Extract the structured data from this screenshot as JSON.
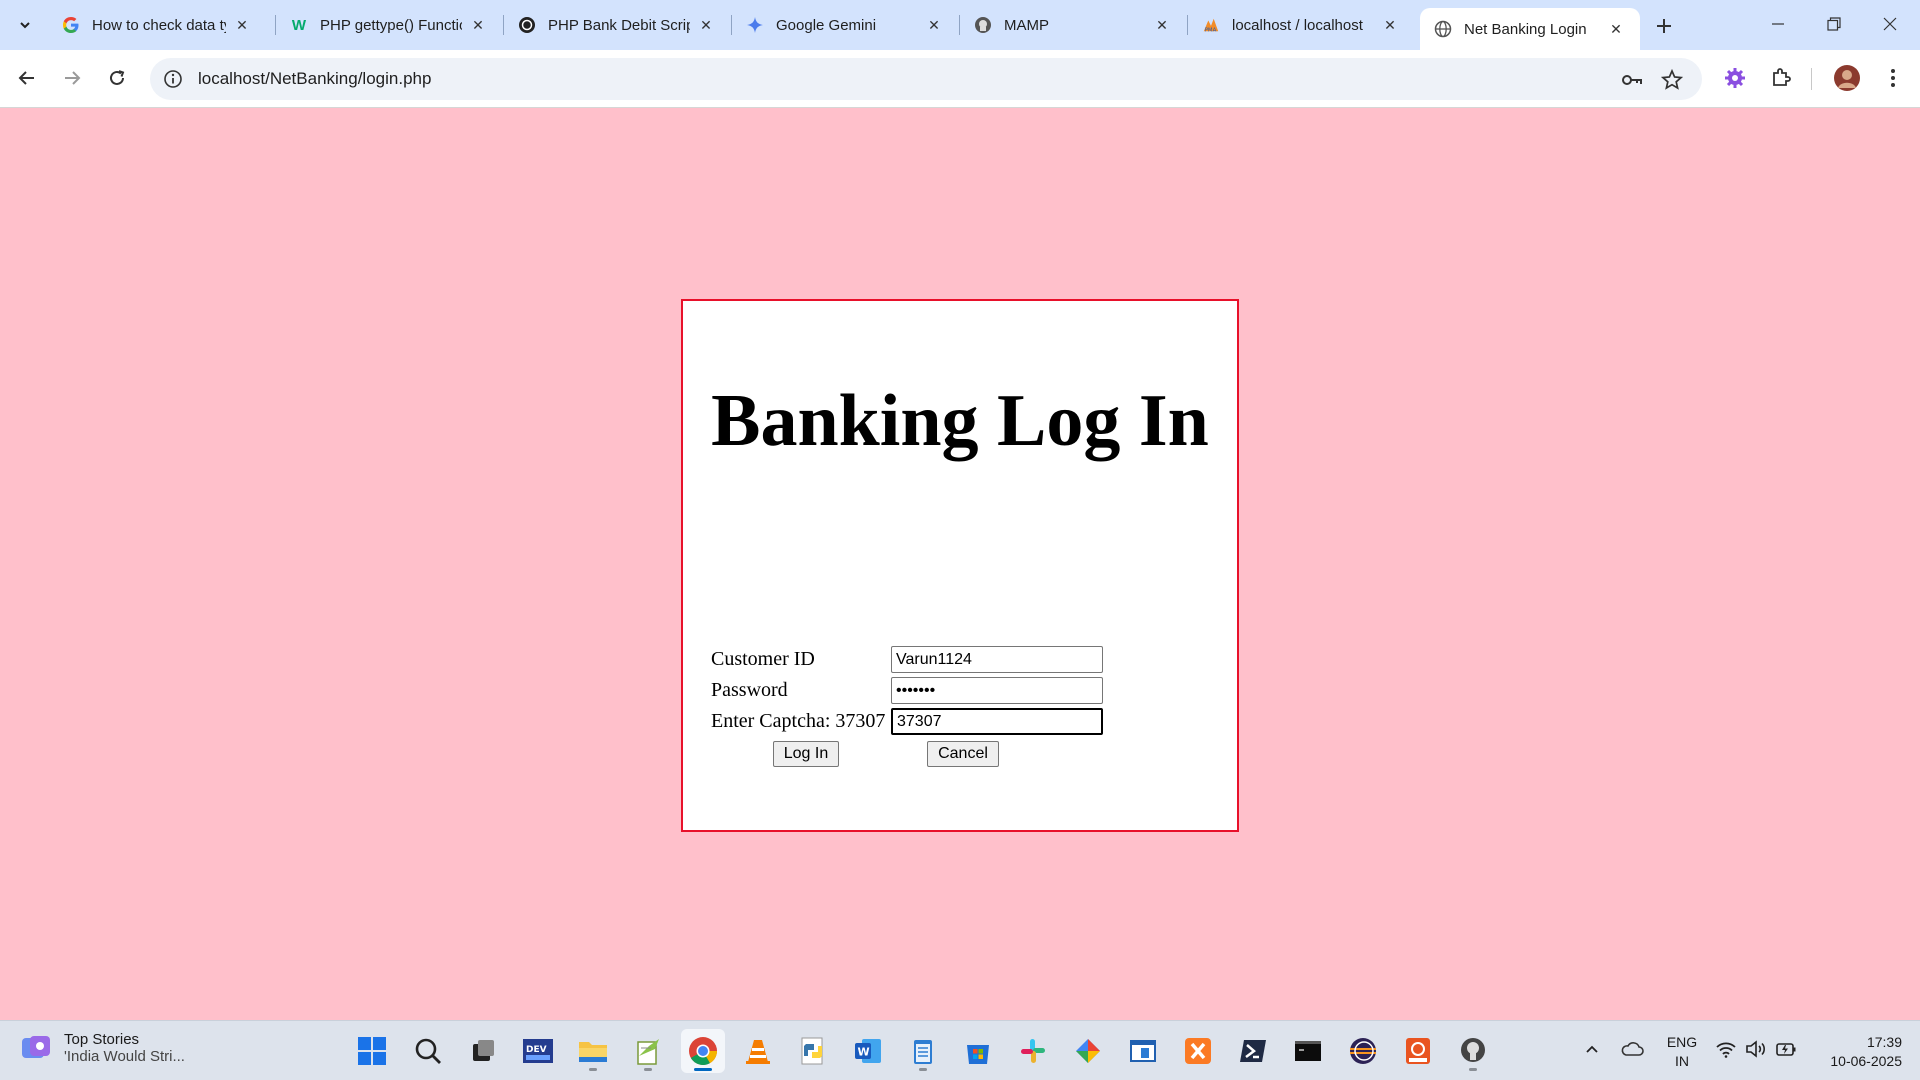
{
  "browser": {
    "tabs": [
      {
        "title": "How to check data ty",
        "icon": "google-icon"
      },
      {
        "title": "PHP gettype() Functio",
        "icon": "w3-icon"
      },
      {
        "title": "PHP Bank Debit Scrip",
        "icon": "chatgpt-icon"
      },
      {
        "title": "Google Gemini",
        "icon": "gemini-icon"
      },
      {
        "title": "MAMP",
        "icon": "mamp-icon"
      },
      {
        "title": "localhost / localhost",
        "icon": "phpmyadmin-icon"
      },
      {
        "title": "Net Banking Login",
        "icon": "globe-icon",
        "active": true
      }
    ],
    "url": "localhost/NetBanking/login.php"
  },
  "page": {
    "title": "Banking Log In",
    "fields": {
      "customer_id_label": "Customer ID",
      "customer_id_value": "Varun1124",
      "password_label": "Password",
      "password_value": "•••••••",
      "captcha_label": "Enter Captcha: 37307",
      "captcha_value": "37307"
    },
    "buttons": {
      "login": "Log In",
      "cancel": "Cancel"
    },
    "colors": {
      "background": "#ffc0cb",
      "border": "#e8102a"
    }
  },
  "taskbar": {
    "widget_title": "Top Stories",
    "widget_subtitle": "'India Would Stri...",
    "lang_line1": "ENG",
    "lang_line2": "IN",
    "time": "17:39",
    "date": "10-06-2025"
  }
}
